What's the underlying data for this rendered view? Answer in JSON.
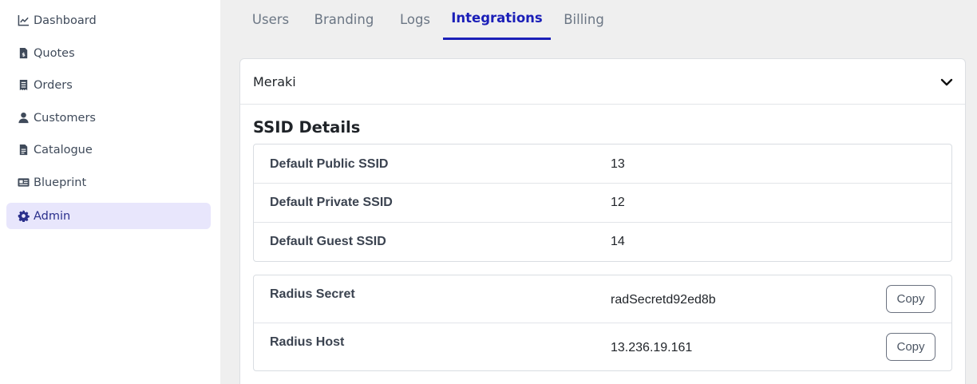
{
  "sidebar": {
    "items": [
      {
        "label": "Dashboard",
        "icon": "chart-line-icon",
        "active": false
      },
      {
        "label": "Quotes",
        "icon": "file-invoice-dollar-icon",
        "active": false
      },
      {
        "label": "Orders",
        "icon": "receipt-icon",
        "active": false
      },
      {
        "label": "Customers",
        "icon": "user-icon",
        "active": false
      },
      {
        "label": "Catalogue",
        "icon": "file-alt-icon",
        "active": false
      },
      {
        "label": "Blueprint",
        "icon": "id-card-icon",
        "active": false
      },
      {
        "label": "Admin",
        "icon": "gear-icon",
        "active": true
      }
    ]
  },
  "tabs": [
    {
      "label": "Users",
      "active": false
    },
    {
      "label": "Branding",
      "active": false
    },
    {
      "label": "Logs",
      "active": false
    },
    {
      "label": "Integrations",
      "active": true
    },
    {
      "label": "Billing",
      "active": false
    }
  ],
  "integration": {
    "name": "Meraki",
    "chevron_icon": "chevron-down-icon",
    "section_title": "SSID Details",
    "ssid_rows": [
      {
        "label": "Default Public SSID",
        "value": "13"
      },
      {
        "label": "Default Private SSID",
        "value": "12"
      },
      {
        "label": "Default Guest SSID",
        "value": "14"
      }
    ],
    "radius_rows": [
      {
        "label": "Radius Secret",
        "value": "radSecretd92ed8b",
        "button": "Copy"
      },
      {
        "label": "Radius Host",
        "value": "13.236.19.161",
        "button": "Copy"
      }
    ]
  },
  "colors": {
    "accent": "#1b1fb8",
    "active_nav_bg": "#e8e6fc",
    "background": "#efefef"
  }
}
